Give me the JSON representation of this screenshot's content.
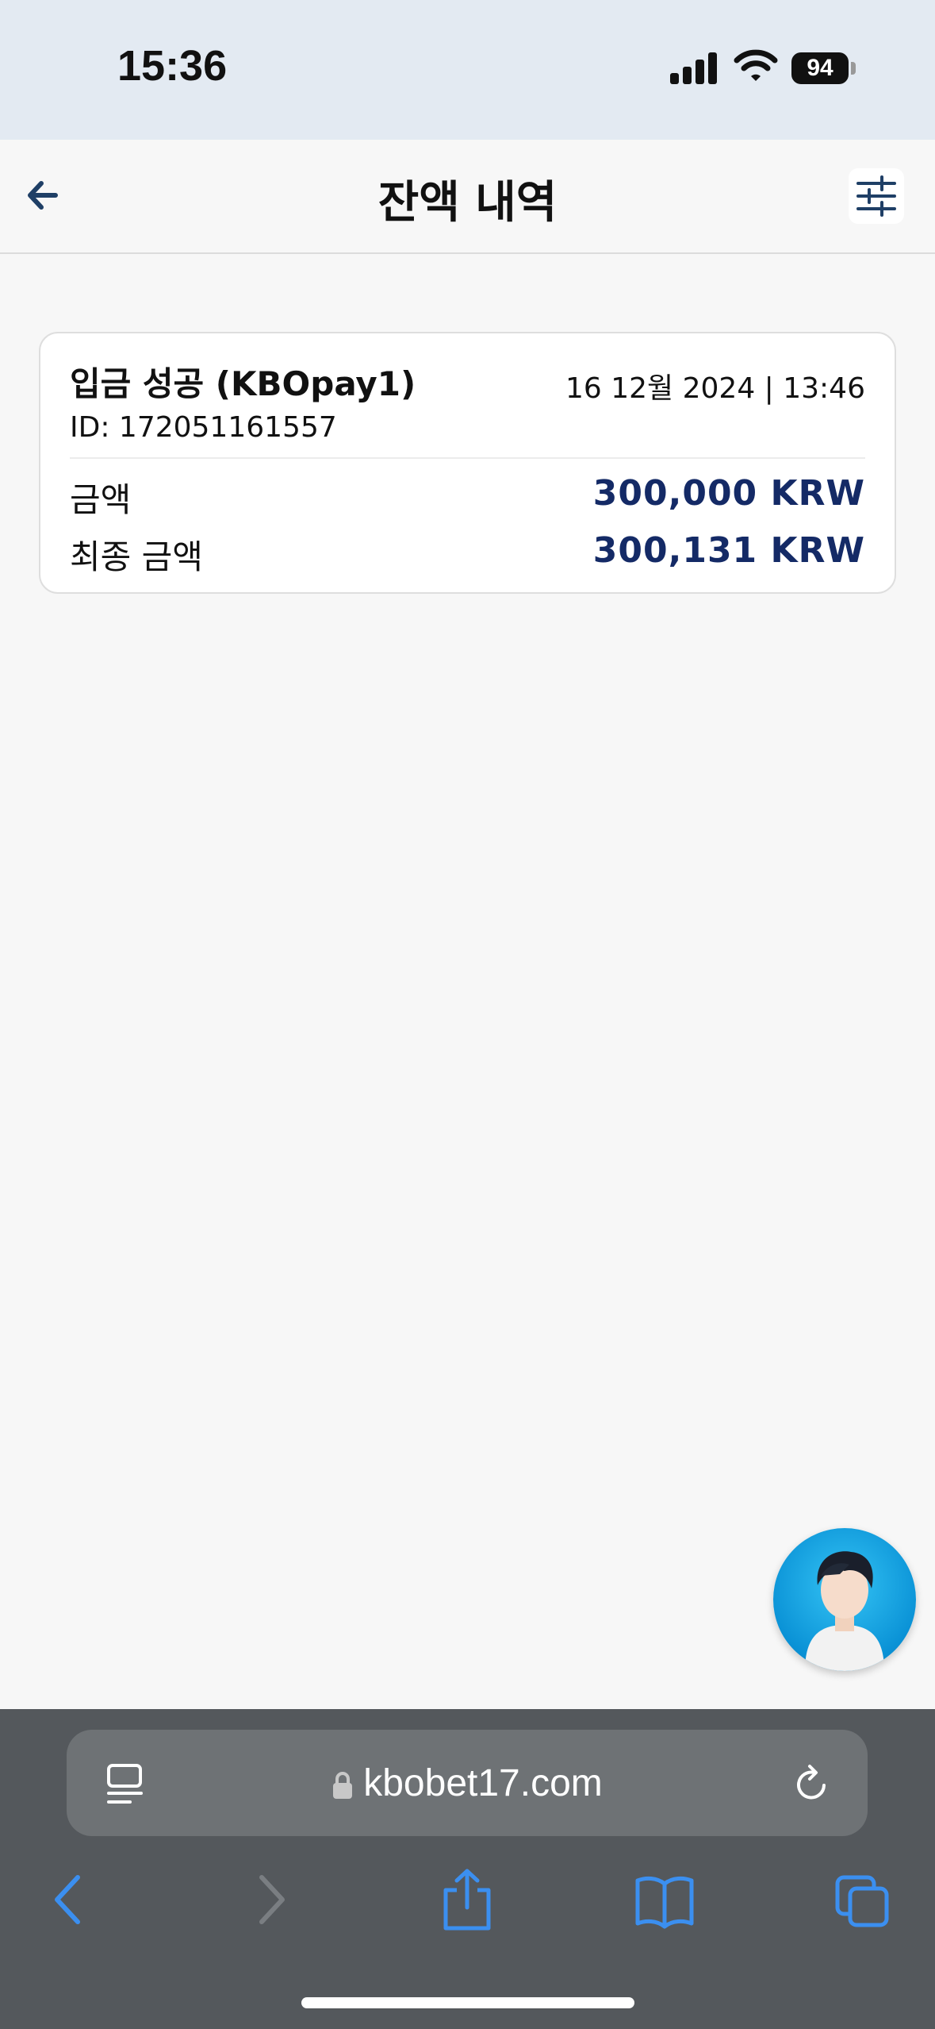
{
  "status_bar": {
    "time": "15:36",
    "battery": "94",
    "icons": [
      "cellular-signal-icon",
      "wifi-icon",
      "battery-icon"
    ]
  },
  "header": {
    "title": "잔액 내역",
    "back_icon": "arrow-left-icon",
    "filter_icon": "sliders-icon"
  },
  "transaction": {
    "title": "입금 성공 (KBOpay1)",
    "date": "16 12월 2024 | 13:46",
    "id": "ID: 172051161557",
    "rows": [
      {
        "label": "금액",
        "value": "300,000 KRW"
      },
      {
        "label": "최종 금액",
        "value": "300,131 KRW"
      }
    ]
  },
  "chat_avatar": "support-avatar",
  "browser": {
    "url": "kbobet17.com",
    "icons": [
      "reader-icon",
      "lock-icon",
      "reload-icon",
      "back-icon",
      "forward-icon",
      "share-icon",
      "bookmarks-icon",
      "tabs-icon"
    ]
  },
  "colors": {
    "accent": "#142a66",
    "back_arrow": "#1f3f66",
    "browser_icons": "#3b8ff0"
  }
}
